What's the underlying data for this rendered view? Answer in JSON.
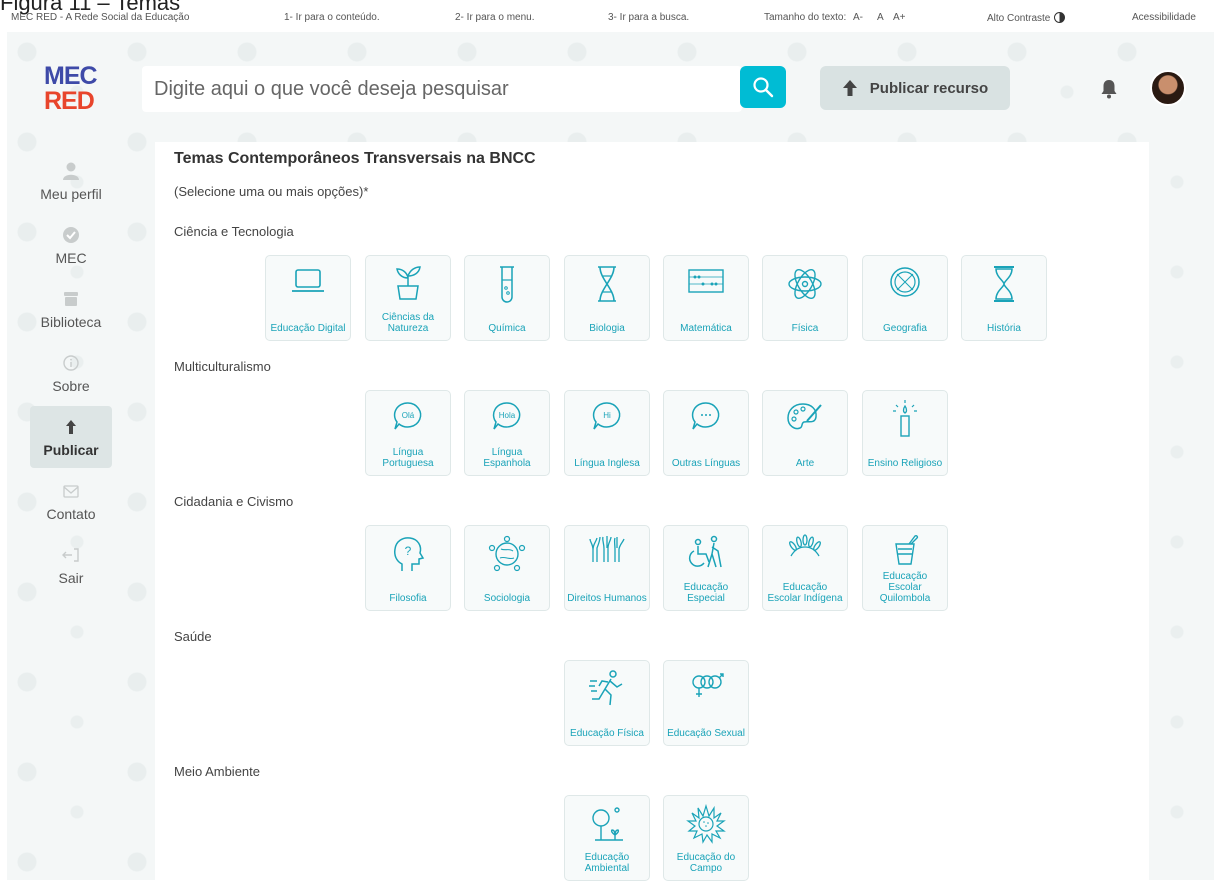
{
  "figure_caption": "Figura 11 – Temas",
  "accessibility_bar": {
    "site_name": "MEC RED - A Rede Social da Educação",
    "skip_content": "1- Ir para o conteúdo.",
    "skip_menu": "2- Ir para o menu.",
    "skip_search": "3- Ir para a busca.",
    "text_size_label": "Tamanho do texto:",
    "text_smaller": "A-",
    "text_normal": "A",
    "text_larger": "A+",
    "high_contrast": "Alto Contraste",
    "accessibility": "Acessibilidade"
  },
  "header": {
    "logo_line1": "MEC",
    "logo_line2": "RED",
    "search_placeholder": "Digite aqui o que você deseja pesquisar",
    "publish_label": "Publicar recurso",
    "accent_color": "#00bcd4"
  },
  "sidebar": {
    "items": [
      {
        "label": "Meu perfil",
        "icon": "user-icon"
      },
      {
        "label": "MEC",
        "icon": "check-circle-icon"
      },
      {
        "label": "Biblioteca",
        "icon": "archive-icon"
      },
      {
        "label": "Sobre",
        "icon": "info-icon"
      },
      {
        "label": "Publicar",
        "icon": "upload-arrow-icon",
        "active": true
      },
      {
        "label": "Contato",
        "icon": "mail-icon"
      },
      {
        "label": "Sair",
        "icon": "logout-icon"
      }
    ]
  },
  "main": {
    "title": "Temas Contemporâneos Transversais na BNCC",
    "subtitle": "(Selecione uma ou mais opções)*",
    "categories": [
      {
        "name": "Ciência e Tecnologia",
        "themes": [
          "Educação Digital",
          "Ciências da Natureza",
          "Química",
          "Biologia",
          "Matemática",
          "Física",
          "Geografia",
          "História"
        ]
      },
      {
        "name": "Multiculturalismo",
        "themes": [
          "Língua Portuguesa",
          "Língua Espanhola",
          "Língua Inglesa",
          "Outras Línguas",
          "Arte",
          "Ensino Religioso"
        ]
      },
      {
        "name": "Cidadania e Civismo",
        "themes": [
          "Filosofia",
          "Sociologia",
          "Direitos Humanos",
          "Educação Especial",
          "Educação Escolar Indígena",
          "Educação Escolar Quilombola"
        ]
      },
      {
        "name": "Saúde",
        "themes": [
          "Educação Física",
          "Educação Sexual"
        ]
      },
      {
        "name": "Meio Ambiente",
        "themes": [
          "Educação Ambiental",
          "Educação do Campo"
        ]
      }
    ]
  }
}
